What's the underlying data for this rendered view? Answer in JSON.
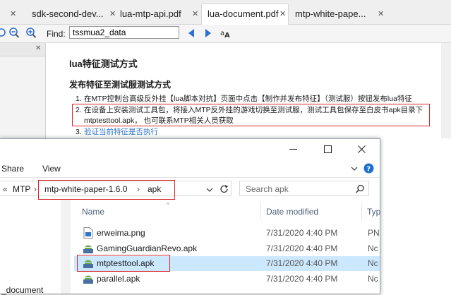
{
  "pdf_viewer": {
    "tabs": [
      {
        "label": "sdk-second-dev...",
        "active": false
      },
      {
        "label": "lua-mtp-api.pdf",
        "active": false
      },
      {
        "label": "lua-document.pdf",
        "active": true
      },
      {
        "label": "mtp-white-pape...",
        "active": false
      }
    ],
    "tab_close_glyph": "✕",
    "find": {
      "label": "Find:",
      "value": "tssmua2_data"
    },
    "doc": {
      "heading": "lua特征测试方式",
      "subheading": "发布特征至测试服测试方式",
      "items": [
        {
          "num": "1.",
          "text": "在MTP控制台高级反外挂【lua脚本对抗】页面中点击【制作并发布特征】（测试服）按钮发布lua特征"
        },
        {
          "num": "2.",
          "text": "在设备上安装测试工具包，将接入MTP反外挂的游戏切换至测试服，测试工具包保存至白皮书apk目录下"
        },
        {
          "num": "",
          "text": "mtptesttool.apk， 也可联系MTP相关人员获取"
        },
        {
          "num": "3.",
          "text": "验证当前特征是否执行"
        }
      ]
    },
    "colors": {
      "highlight_box": "#d9252a",
      "link": "#2e74c9",
      "nav_arrow": "#2f6fd1"
    }
  },
  "explorer": {
    "ribbon": {
      "share": "Share",
      "view": "View"
    },
    "address": {
      "prefix": "«",
      "items": [
        "MTP",
        "mtp-white-paper-1.6.0",
        "apk"
      ],
      "separator": "›"
    },
    "search_placeholder": "Search apk",
    "nav": {
      "item": "_document"
    },
    "columns": {
      "name": "Name",
      "date": "Date modified",
      "type": "Typ"
    },
    "files": [
      {
        "name": "erweima.png",
        "date": "7/31/2020 4:40 PM",
        "type": "PN",
        "icon": "image-file-icon",
        "selected": false
      },
      {
        "name": "GamingGuardianRevo.apk",
        "date": "7/31/2020 4:40 PM",
        "type": "Nc",
        "icon": "apk-file-icon",
        "selected": false
      },
      {
        "name": "mtptesttool.apk",
        "date": "7/31/2020 4:40 PM",
        "type": "Nc",
        "icon": "apk-file-icon",
        "selected": true
      },
      {
        "name": "parallel.apk",
        "date": "7/31/2020 4:40 PM",
        "type": "Nc",
        "icon": "apk-file-icon",
        "selected": false
      }
    ],
    "colors": {
      "selection": "#cce8ff",
      "header_text": "#4c607a"
    }
  }
}
